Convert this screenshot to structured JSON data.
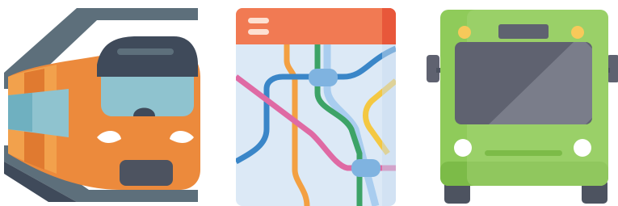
{
  "icons": [
    {
      "id": "train",
      "name": "train-icon"
    },
    {
      "id": "map",
      "name": "transit-map-icon"
    },
    {
      "id": "bus",
      "name": "bus-icon"
    }
  ],
  "colors": {
    "train_orange": "#ec8a3c",
    "train_orange_light": "#f2a14c",
    "train_cab": "#3f4a5a",
    "train_window": "#8fc3cf",
    "rail_gray": "#5d6f7b",
    "map_header": "#f17a53",
    "map_header_dark": "#e8573a",
    "map_bg": "#dce9f6",
    "line_blue": "#3a86c8",
    "line_green": "#3da367",
    "line_orange": "#f3a042",
    "line_pink": "#df6aa4",
    "line_yellow": "#f4c842",
    "line_lightblue": "#a9cdef",
    "bus_green": "#8fcb5a",
    "bus_green_light": "#a8d67a",
    "bus_window": "#5f6270",
    "bus_gray": "#4d5360",
    "bus_light": "#f7c95a"
  }
}
